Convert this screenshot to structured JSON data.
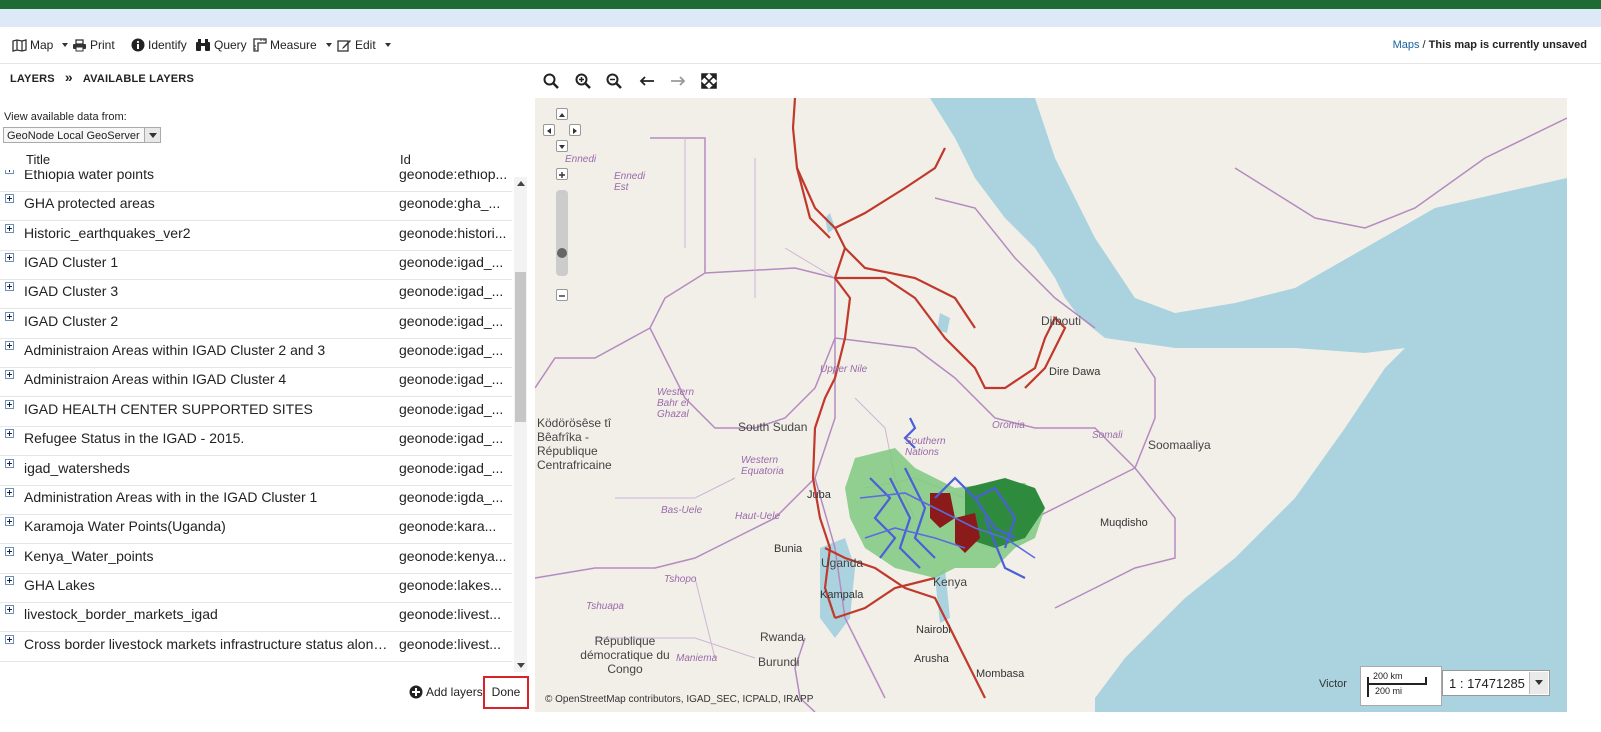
{
  "toolbar": {
    "map_label": "Map",
    "print_label": "Print",
    "identify_label": "Identify",
    "query_label": "Query",
    "measure_label": "Measure",
    "edit_label": "Edit",
    "maps_link": "Maps",
    "separator": " / ",
    "status_text": "This map is currently unsaved"
  },
  "panel": {
    "breadcrumb_layers": "LAYERS",
    "breadcrumb_sep": "»",
    "breadcrumb_available": "AVAILABLE LAYERS",
    "source_label": "View available data from:",
    "source_value": "GeoNode Local GeoServer",
    "col_title": "Title",
    "col_id": "Id",
    "rows": [
      {
        "title": "Ethiopia water points",
        "id": "geonode:ethiop..."
      },
      {
        "title": "GHA protected areas",
        "id": "geonode:gha_..."
      },
      {
        "title": "Historic_earthquakes_ver2",
        "id": "geonode:histori..."
      },
      {
        "title": "IGAD Cluster 1",
        "id": "geonode:igad_..."
      },
      {
        "title": "IGAD Cluster 3",
        "id": "geonode:igad_..."
      },
      {
        "title": "IGAD Cluster 2",
        "id": "geonode:igad_..."
      },
      {
        "title": "Administraion Areas within IGAD Cluster 2 and 3",
        "id": "geonode:igad_..."
      },
      {
        "title": "Administraion Areas within IGAD Cluster 4",
        "id": "geonode:igad_..."
      },
      {
        "title": "IGAD HEALTH CENTER SUPPORTED SITES",
        "id": "geonode:igad_..."
      },
      {
        "title": "Refugee Status in the IGAD - 2015.",
        "id": "geonode:igad_..."
      },
      {
        "title": "igad_watersheds",
        "id": "geonode:igad_..."
      },
      {
        "title": "Administration Areas with in the IGAD Cluster 1",
        "id": "geonode:igda_..."
      },
      {
        "title": "Karamoja Water Points(Uganda)",
        "id": "geonode:kara..."
      },
      {
        "title": "Kenya_Water_points",
        "id": "geonode:kenya..."
      },
      {
        "title": "GHA Lakes",
        "id": "geonode:lakes..."
      },
      {
        "title": "livestock_border_markets_igad",
        "id": "geonode:livest..."
      },
      {
        "title": "Cross border livestock markets infrastructure status along...",
        "id": "geonode:livest..."
      }
    ],
    "add_layers_label": "Add layers",
    "done_label": "Done"
  },
  "map": {
    "attribution": "© OpenStreetMap contributors, IGAD_SEC, ICPALD, IRAPP",
    "scale_km": "200 km",
    "scale_mi": "200 mi",
    "scale_value": "1 : 17471285",
    "labels": {
      "south_sudan": "South Sudan",
      "kenya": "Kenya",
      "uganda": "Uganda",
      "djibouti": "Djibouti",
      "kampala": "Kampala",
      "nairobi": "Nairobi",
      "arusha": "Arusha",
      "mombasa": "Mombasa",
      "juba": "Juba",
      "bunia": "Bunia",
      "rwanda": "Rwanda",
      "burundi": "Burundi",
      "muqdisho": "Muqdisho",
      "dawa": "Dire Dawa",
      "oromia": "Oromia",
      "somali": "Somali",
      "soomaaliya": "Soomaaliya",
      "rdc": "République démocratique du Congo",
      "kodorosese": "Ködörösêse tî Bêafrîka - République Centrafricaine",
      "upper_nile": "Upper Nile",
      "western_equatoria": "Western Equatoria",
      "western_bahr": "Western Bahr el Ghazal",
      "southern_nations": "Southern Nations",
      "haut_uele": "Haut-Uele",
      "bas_uele": "Bas-Uele",
      "tshopo": "Tshopo",
      "tshuapa": "Tshuapa",
      "maniema": "Maniema",
      "victoria": "Victor",
      "ennedi": "Ennedi",
      "ennedi_est": "Ennedi Est"
    }
  }
}
